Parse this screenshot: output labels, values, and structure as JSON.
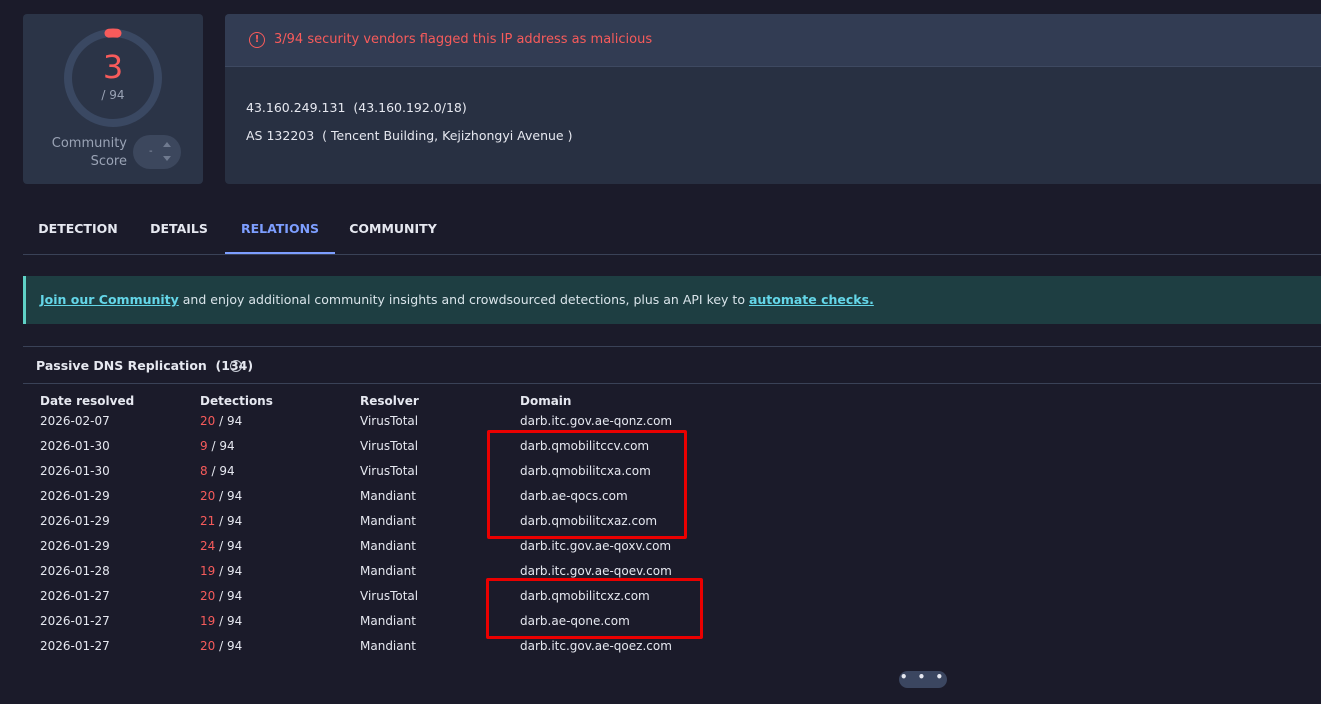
{
  "score": {
    "detections": "3",
    "total": "/ 94",
    "community_label_1": "Community",
    "community_label_2": "Score",
    "community_value": "-"
  },
  "alert": {
    "text": "3/94 security vendors flagged this IP address as malicious",
    "icon": "exclamation-circle-icon"
  },
  "ip_info": {
    "ip": "43.160.249.131",
    "cidr": "(43.160.192.0/18)",
    "as_number": "AS 132203",
    "as_owner": "( Tencent Building, Kejizhongyi Avenue )"
  },
  "tabs": [
    {
      "label": "DETECTION",
      "active": false
    },
    {
      "label": "DETAILS",
      "active": false
    },
    {
      "label": "RELATIONS",
      "active": true
    },
    {
      "label": "COMMUNITY",
      "active": false
    }
  ],
  "banner": {
    "link1": "Join our Community",
    "middle": " and enjoy additional community insights and crowdsourced detections, plus an API key to ",
    "link2": "automate checks."
  },
  "dns": {
    "title": "Passive DNS Replication",
    "count": "(134)",
    "columns": {
      "date": "Date resolved",
      "detections": "Detections",
      "resolver": "Resolver",
      "domain": "Domain"
    },
    "rows": [
      {
        "date": "2026-02-07",
        "det": "20",
        "total": " / 94",
        "resolver": "VirusTotal",
        "domain": "darb.itc.gov.ae-qonz.com"
      },
      {
        "date": "2026-01-30",
        "det": "9",
        "total": " / 94",
        "resolver": "VirusTotal",
        "domain": "darb.qmobilitccv.com"
      },
      {
        "date": "2026-01-30",
        "det": "8",
        "total": " / 94",
        "resolver": "VirusTotal",
        "domain": "darb.qmobilitcxa.com"
      },
      {
        "date": "2026-01-29",
        "det": "20",
        "total": " / 94",
        "resolver": "Mandiant",
        "domain": "darb.ae-qocs.com"
      },
      {
        "date": "2026-01-29",
        "det": "21",
        "total": " / 94",
        "resolver": "Mandiant",
        "domain": "darb.qmobilitcxaz.com"
      },
      {
        "date": "2026-01-29",
        "det": "24",
        "total": " / 94",
        "resolver": "Mandiant",
        "domain": "darb.itc.gov.ae-qoxv.com"
      },
      {
        "date": "2026-01-28",
        "det": "19",
        "total": " / 94",
        "resolver": "Mandiant",
        "domain": "darb.itc.gov.ae-qoev.com"
      },
      {
        "date": "2026-01-27",
        "det": "20",
        "total": " / 94",
        "resolver": "VirusTotal",
        "domain": "darb.qmobilitcxz.com"
      },
      {
        "date": "2026-01-27",
        "det": "19",
        "total": " / 94",
        "resolver": "Mandiant",
        "domain": "darb.ae-qone.com"
      },
      {
        "date": "2026-01-27",
        "det": "20",
        "total": " / 94",
        "resolver": "Mandiant",
        "domain": "darb.itc.gov.ae-qoez.com"
      }
    ]
  },
  "more_button": "• • •",
  "colors": {
    "malicious": "#f75b5b",
    "accent": "#7d9eff",
    "highlight": "#ea0000"
  }
}
